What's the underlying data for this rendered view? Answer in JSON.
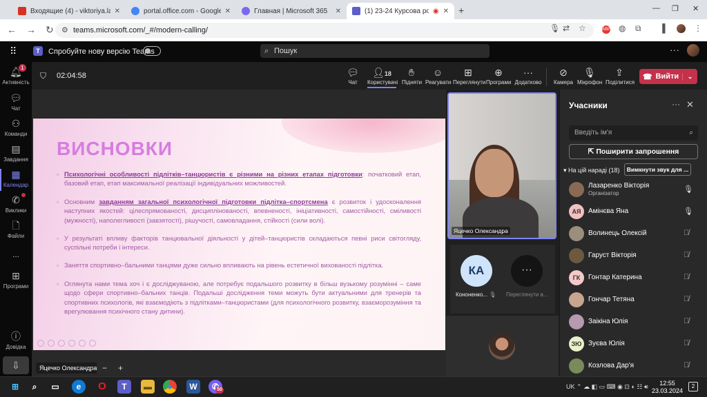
{
  "browser": {
    "tabs": [
      {
        "label": "Входящие (4) - viktoriya.lazarenko",
        "color": "#d93025"
      },
      {
        "label": "portal.office.com - Google Search",
        "color": "#4285f4"
      },
      {
        "label": "Главная | Microsoft 365",
        "color": "#7b68ee"
      },
      {
        "label": "(1) 23-24 Курсова робота",
        "color": "#5b5fc7"
      }
    ],
    "url": "teams.microsoft.com/_#/modern-calling/"
  },
  "teams": {
    "try_new": "Спробуйте нову версію Teams",
    "search_placeholder": "Пошук",
    "rail": [
      {
        "label": "Активність",
        "badge": "1"
      },
      {
        "label": "Чат"
      },
      {
        "label": "Команди"
      },
      {
        "label": "Завдання"
      },
      {
        "label": "Календар"
      },
      {
        "label": "Виклики"
      },
      {
        "label": "Файли"
      },
      {
        "label": "..."
      },
      {
        "label": "Програми"
      },
      {
        "label": "Довідка"
      }
    ]
  },
  "meeting": {
    "timer": "02:04:58",
    "buttons": {
      "chat": "Чат",
      "people": "Користувачі",
      "people_count": "18",
      "raise": "Підняти",
      "react": "Реагувати",
      "view": "Переглянути",
      "apps": "Програми",
      "more": "Додатково",
      "camera": "Камера",
      "mic": "Мікрофон",
      "share": "Поділитися",
      "leave": "Вийти"
    }
  },
  "slide": {
    "title": "ВИСНОВКИ",
    "b1_bold": "Психологічні особливості підлітків–танцюристів є різними на різних етапах підготовки",
    "b1_rest": ": початковий етап, базовий етап, етап максимальної реалізації індивідуальних можливостей.",
    "b2_pre": "Основним ",
    "b2_bold": "завданням загальної психологічної підготовки підлітка–спортсмена",
    "b2_rest": " є розвиток і удосконалення наступних якостей: цілеспрямованості, дисциплінованості, впевненості, ініціативності, самостійності, сміливості (мужності), наполегливості (завзятості), рішучості, самовладання, стійкості (сили волі).",
    "b3": "У результаті впливу факторів танцювальної діяльності у дітей–танцюристів складаються певні риси світогляду, суспільні потреби і інтереси.",
    "b4": "Заняття спортивно–бальними танцями дуже сильно впливають на рівень естетичної вихованості підлітка.",
    "b5": "Оглянута нами тема хоч і є досліджуваною, але потребує подальшого розвитку в більш вузькому розумінні – саме щодо сфери спортивно–бальних танців. Подальші дослідження теми можуть бути актуальними для тренерів та спортивних психологів, які взаємодіють з підлітками–танцюристами (для психологічного розвитку, взаєморозуміння та врегулювання психічного стану дитини)."
  },
  "presenter": "Яцечко Олександра",
  "videos": {
    "main": "Яцечко Олександра",
    "tile1_initials": "КА",
    "tile1_name": "Кононенко...",
    "tile2_name": "Переглянути в..."
  },
  "participants": {
    "title": "Учасники",
    "search_placeholder": "Введіть ім'я",
    "share_invite": "Поширити запрошення",
    "section": "На цій нараді (18)",
    "mute_all": "Вимкнути звук для ...",
    "people": [
      {
        "name": "Лазаренко Вікторія",
        "role": "Організатор",
        "initials": "",
        "color": "#8a6a55",
        "mic": "on"
      },
      {
        "name": "Амінєва Яна",
        "initials": "АЯ",
        "color": "#f3c0c0",
        "mic": "on"
      },
      {
        "name": "Волинець Олексій",
        "initials": "",
        "color": "#9a8f7a",
        "mic": "off"
      },
      {
        "name": "Гаруст Вікторія",
        "initials": "",
        "color": "#6d5a3e",
        "mic": "off"
      },
      {
        "name": "Гонтар Катерина",
        "initials": "ГК",
        "color": "#f5c9c9",
        "mic": "off"
      },
      {
        "name": "Гончар Тетяна",
        "initials": "",
        "color": "#c8a590",
        "mic": "off"
      },
      {
        "name": "Заікіна Юлія",
        "initials": "",
        "color": "#b59ab0",
        "mic": "off"
      },
      {
        "name": "Зуєва Юлія",
        "initials": "ЗЮ",
        "color": "#e9f1c9",
        "mic": "off"
      },
      {
        "name": "Козлова Дар'я",
        "initials": "",
        "color": "#7a8a5a",
        "mic": "off"
      }
    ]
  },
  "taskbar": {
    "lang": "UK",
    "time": "12:55",
    "date": "23.03.2024",
    "notif": "2",
    "viber_badge": "50"
  }
}
